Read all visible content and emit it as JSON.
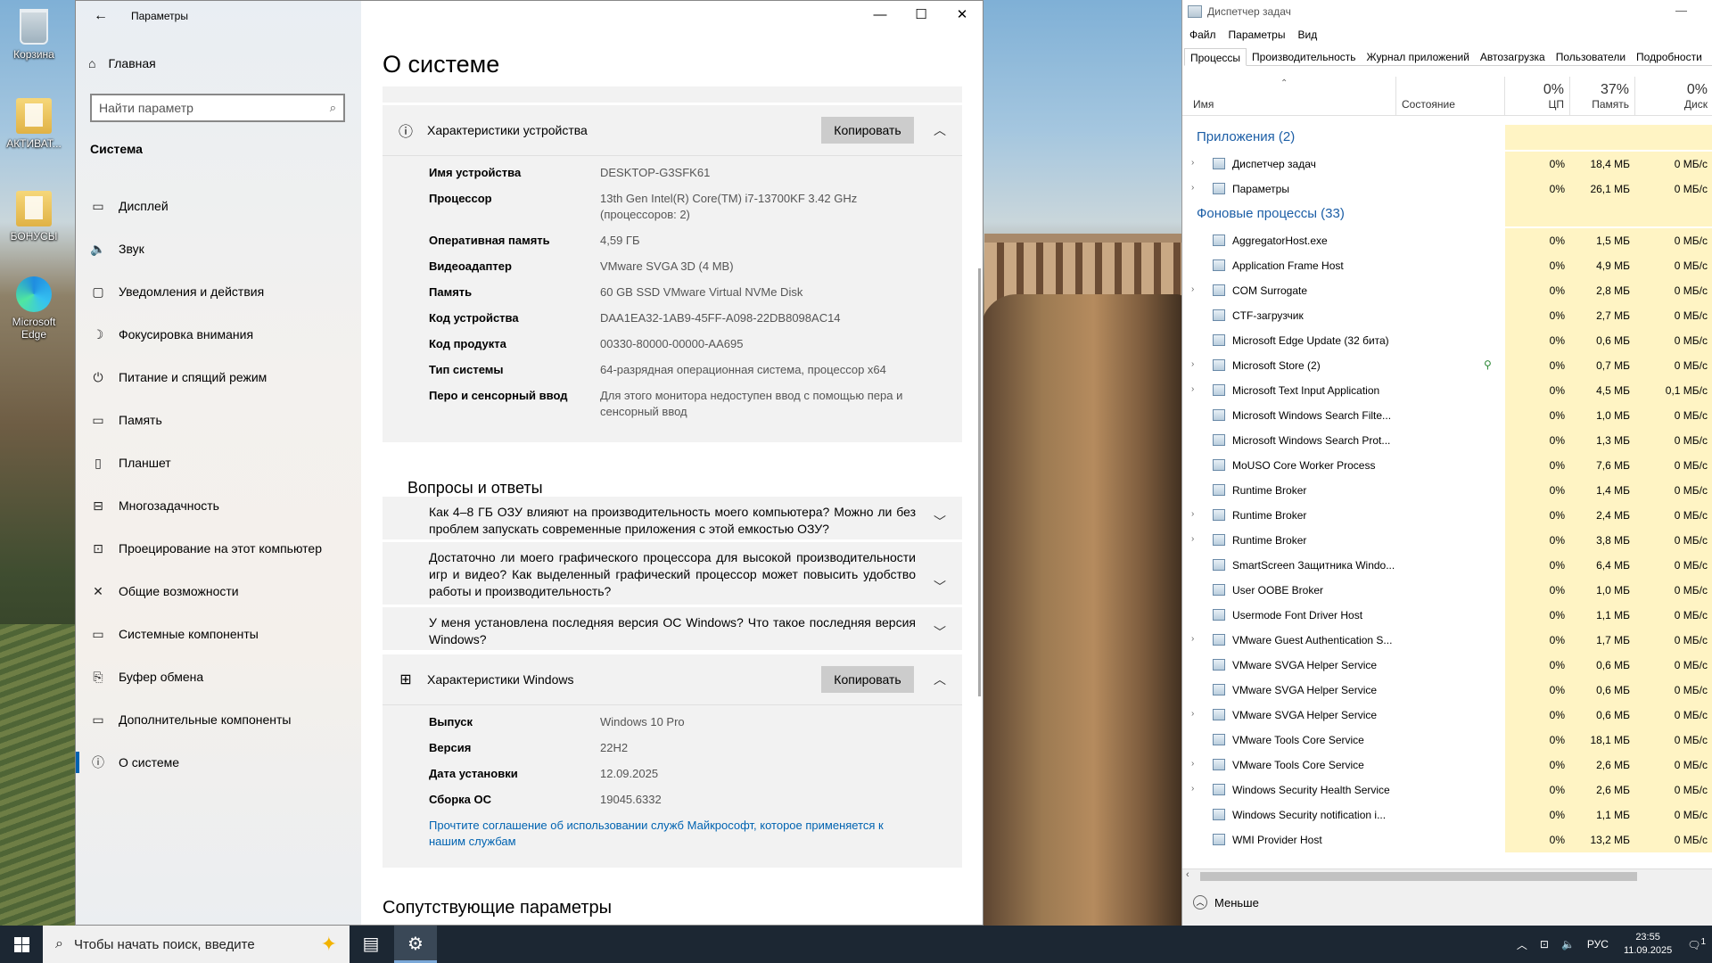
{
  "desktop": {
    "icons": [
      {
        "label": "Корзина"
      },
      {
        "label": "АКТИВАТ..."
      },
      {
        "label": "БОНУСЫ"
      },
      {
        "label": "Microsoft Edge"
      }
    ]
  },
  "settings": {
    "window_title": "Параметры",
    "controls": {
      "minimize": "—",
      "maximize": "☐",
      "close": "✕"
    },
    "sidebar": {
      "home": "Главная",
      "search_placeholder": "Найти параметр",
      "section": "Система",
      "items": [
        {
          "label": "Дисплей",
          "icon": "▭"
        },
        {
          "label": "Звук",
          "icon": "🔈"
        },
        {
          "label": "Уведомления и действия",
          "icon": "▢"
        },
        {
          "label": "Фокусировка внимания",
          "icon": "☽"
        },
        {
          "label": "Питание и спящий режим",
          "icon": "⏻"
        },
        {
          "label": "Память",
          "icon": "▭"
        },
        {
          "label": "Планшет",
          "icon": "▯"
        },
        {
          "label": "Многозадачность",
          "icon": "⊟"
        },
        {
          "label": "Проецирование на этот компьютер",
          "icon": "⊡"
        },
        {
          "label": "Общие возможности",
          "icon": "✕"
        },
        {
          "label": "Системные компоненты",
          "icon": "▭"
        },
        {
          "label": "Буфер обмена",
          "icon": "⎘"
        },
        {
          "label": "Дополнительные компоненты",
          "icon": "▭"
        },
        {
          "label": "О системе",
          "icon": "ⓘ"
        }
      ]
    },
    "main": {
      "title": "О системе",
      "device_card": {
        "title": "Характеристики устройства",
        "copy_label": "Копировать",
        "rows": [
          {
            "k": "Имя устройства",
            "v": "DESKTOP-G3SFK61"
          },
          {
            "k": "Процессор",
            "v": "13th Gen Intel(R) Core(TM) i7-13700KF 3.42 GHz (процессоров: 2)"
          },
          {
            "k": "Оперативная память",
            "v": "4,59 ГБ"
          },
          {
            "k": "Видеоадаптер",
            "v": "VMware SVGA 3D (4 MB)"
          },
          {
            "k": "Память",
            "v": "60 GB SSD VMware Virtual NVMe Disk"
          },
          {
            "k": "Код устройства",
            "v": "DAA1EA32-1AB9-45FF-A098-22DB8098AC14"
          },
          {
            "k": "Код продукта",
            "v": "00330-80000-00000-AA695"
          },
          {
            "k": "Тип системы",
            "v": "64-разрядная операционная система, процессор x64"
          },
          {
            "k": "Перо и сенсорный ввод",
            "v": "Для этого монитора недоступен ввод с помощью пера и сенсорный ввод"
          }
        ]
      },
      "qa": {
        "title": "Вопросы и ответы",
        "items": [
          "Как 4–8 ГБ ОЗУ влияют на производительность моего компьютера? Можно ли без проблем запускать современные приложения с этой емкостью ОЗУ?",
          "Достаточно ли моего графического процессора для высокой производительности игр и видео? Как выделенный графический процессор может повысить удобство работы и производительность?",
          "У меня установлена последняя версия ОС Windows? Что такое последняя версия Windows?"
        ]
      },
      "windows_card": {
        "title": "Характеристики Windows",
        "copy_label": "Копировать",
        "rows": [
          {
            "k": "Выпуск",
            "v": "Windows 10 Pro"
          },
          {
            "k": "Версия",
            "v": "22H2"
          },
          {
            "k": "Дата установки",
            "v": "12.09.2025"
          },
          {
            "k": "Сборка ОС",
            "v": "19045.6332"
          }
        ],
        "link": "Прочтите соглашение об использовании служб Майкрософт, которое применяется к нашим службам"
      },
      "related": "Сопутствующие параметры"
    }
  },
  "taskmgr": {
    "title": "Диспетчер задач",
    "menu": [
      "Файл",
      "Параметры",
      "Вид"
    ],
    "tabs": [
      "Процессы",
      "Производительность",
      "Журнал приложений",
      "Автозагрузка",
      "Пользователи",
      "Подробности"
    ],
    "columns": {
      "name": "Имя",
      "status": "Состояние",
      "cpu_pct": "0%",
      "cpu": "ЦП",
      "mem_pct": "37%",
      "mem": "Память",
      "disk_pct": "0%",
      "disk": "Диск"
    },
    "groups": {
      "apps": "Приложения (2)",
      "bg": "Фоновые процессы (33)"
    },
    "apps": [
      {
        "name": "Диспетчер задач",
        "cpu": "0%",
        "mem": "18,4 МБ",
        "disk": "0 МБ/с",
        "exp": true
      },
      {
        "name": "Параметры",
        "cpu": "0%",
        "mem": "26,1 МБ",
        "disk": "0 МБ/с",
        "exp": true
      }
    ],
    "bg": [
      {
        "name": "AggregatorHost.exe",
        "cpu": "0%",
        "mem": "1,5 МБ",
        "disk": "0 МБ/с",
        "exp": false
      },
      {
        "name": "Application Frame Host",
        "cpu": "0%",
        "mem": "4,9 МБ",
        "disk": "0 МБ/с",
        "exp": false
      },
      {
        "name": "COM Surrogate",
        "cpu": "0%",
        "mem": "2,8 МБ",
        "disk": "0 МБ/с",
        "exp": true
      },
      {
        "name": "CTF-загрузчик",
        "cpu": "0%",
        "mem": "2,7 МБ",
        "disk": "0 МБ/с",
        "exp": false
      },
      {
        "name": "Microsoft Edge Update (32 бита)",
        "cpu": "0%",
        "mem": "0,6 МБ",
        "disk": "0 МБ/с",
        "exp": false
      },
      {
        "name": "Microsoft Store (2)",
        "cpu": "0%",
        "mem": "0,7 МБ",
        "disk": "0 МБ/с",
        "exp": true,
        "leaf": true
      },
      {
        "name": "Microsoft Text Input Application",
        "cpu": "0%",
        "mem": "4,5 МБ",
        "disk": "0,1 МБ/с",
        "exp": true
      },
      {
        "name": "Microsoft Windows Search Filte...",
        "cpu": "0%",
        "mem": "1,0 МБ",
        "disk": "0 МБ/с",
        "exp": false
      },
      {
        "name": "Microsoft Windows Search Prot...",
        "cpu": "0%",
        "mem": "1,3 МБ",
        "disk": "0 МБ/с",
        "exp": false
      },
      {
        "name": "MoUSO Core Worker Process",
        "cpu": "0%",
        "mem": "7,6 МБ",
        "disk": "0 МБ/с",
        "exp": false
      },
      {
        "name": "Runtime Broker",
        "cpu": "0%",
        "mem": "1,4 МБ",
        "disk": "0 МБ/с",
        "exp": false
      },
      {
        "name": "Runtime Broker",
        "cpu": "0%",
        "mem": "2,4 МБ",
        "disk": "0 МБ/с",
        "exp": true
      },
      {
        "name": "Runtime Broker",
        "cpu": "0%",
        "mem": "3,8 МБ",
        "disk": "0 МБ/с",
        "exp": true
      },
      {
        "name": "SmartScreen Защитника Windo...",
        "cpu": "0%",
        "mem": "6,4 МБ",
        "disk": "0 МБ/с",
        "exp": false
      },
      {
        "name": "User OOBE Broker",
        "cpu": "0%",
        "mem": "1,0 МБ",
        "disk": "0 МБ/с",
        "exp": false
      },
      {
        "name": "Usermode Font Driver Host",
        "cpu": "0%",
        "mem": "1,1 МБ",
        "disk": "0 МБ/с",
        "exp": false
      },
      {
        "name": "VMware Guest Authentication S...",
        "cpu": "0%",
        "mem": "1,7 МБ",
        "disk": "0 МБ/с",
        "exp": true
      },
      {
        "name": "VMware SVGA Helper Service",
        "cpu": "0%",
        "mem": "0,6 МБ",
        "disk": "0 МБ/с",
        "exp": false
      },
      {
        "name": "VMware SVGA Helper Service",
        "cpu": "0%",
        "mem": "0,6 МБ",
        "disk": "0 МБ/с",
        "exp": false
      },
      {
        "name": "VMware SVGA Helper Service",
        "cpu": "0%",
        "mem": "0,6 МБ",
        "disk": "0 МБ/с",
        "exp": true
      },
      {
        "name": "VMware Tools Core Service",
        "cpu": "0%",
        "mem": "18,1 МБ",
        "disk": "0 МБ/с",
        "exp": false
      },
      {
        "name": "VMware Tools Core Service",
        "cpu": "0%",
        "mem": "2,6 МБ",
        "disk": "0 МБ/с",
        "exp": true
      },
      {
        "name": "Windows Security Health Service",
        "cpu": "0%",
        "mem": "2,6 МБ",
        "disk": "0 МБ/с",
        "exp": true
      },
      {
        "name": "Windows Security notification i...",
        "cpu": "0%",
        "mem": "1,1 МБ",
        "disk": "0 МБ/с",
        "exp": false
      },
      {
        "name": "WMI Provider Host",
        "cpu": "0%",
        "mem": "13,2 МБ",
        "disk": "0 МБ/с",
        "exp": false
      }
    ],
    "less": "Меньше"
  },
  "taskbar": {
    "search_placeholder": "Чтобы начать поиск, введите",
    "lang": "РУС",
    "time": "23:55",
    "date": "11.09.2025",
    "notif_count": "1"
  },
  "colors": {
    "accent": "#0063b1",
    "tm_highlight": "#fff4c4",
    "tm_group": "#1c5ea6"
  }
}
